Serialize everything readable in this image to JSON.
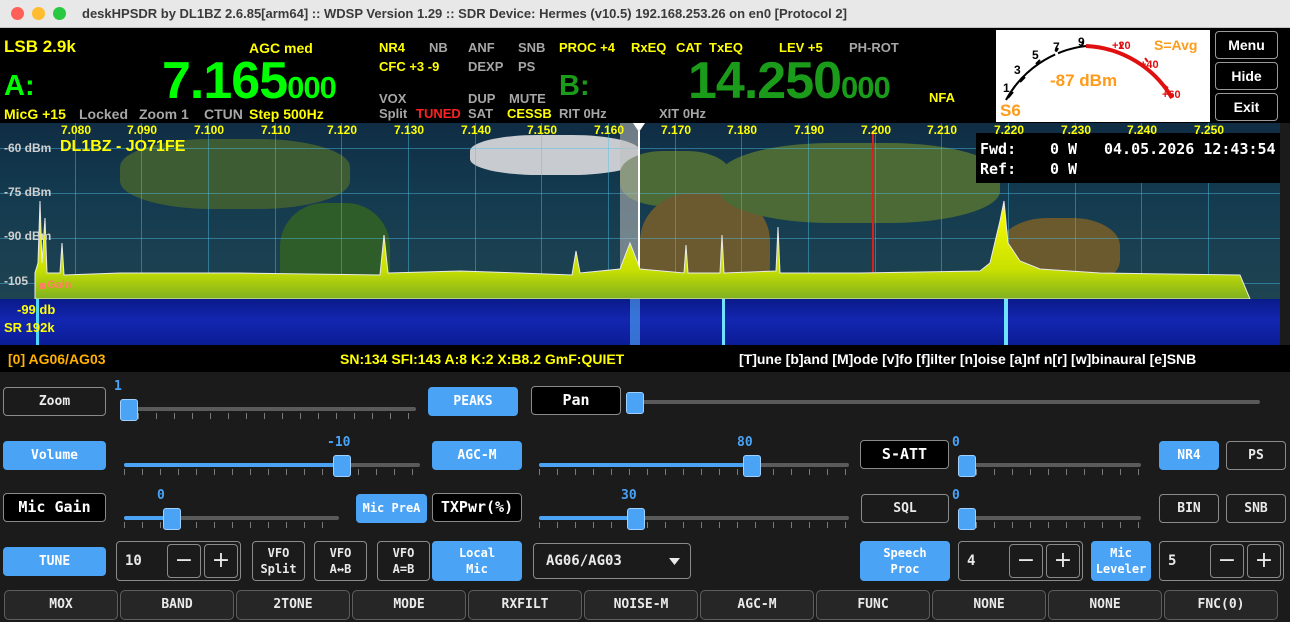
{
  "window": {
    "title": "deskHPSDR by DL1BZ 2.6.85[arm64] :: WDSP Version 1.29 :: SDR Device: Hermes (v10.5) 192.168.253.26 on en0 [Protocol 2]"
  },
  "vfo_a": {
    "mode_filter": "LSB 2.9k",
    "agc": "AGC med",
    "label": "A:",
    "freq_main": "7.165",
    "freq_small": "000",
    "mic_gain": "MicG +15",
    "locked": "Locked",
    "zoom": "Zoom 1",
    "ctun": "CTUN",
    "step": "Step 500Hz"
  },
  "status": {
    "nr": "NR4",
    "nb": "NB",
    "anf": "ANF",
    "snb": "SNB",
    "cfc": "CFC +3 -9",
    "dexp": "DEXP",
    "ps": "PS",
    "vox": "VOX",
    "dup": "DUP",
    "mute": "MUTE",
    "split": "Split",
    "tuned": "TUNED",
    "sat": "SAT",
    "cessb": "CESSB",
    "rit": "RIT 0Hz",
    "xit": "XIT 0Hz",
    "proc": "PROC +4",
    "rxeq": "RxEQ",
    "cat": "CAT",
    "txeq": "TxEQ",
    "lev": "LEV +5",
    "phrot": "PH-ROT"
  },
  "vfo_b": {
    "label": "B:",
    "freq_main": "14.250",
    "freq_small": "000",
    "nfa": "NFA"
  },
  "meter": {
    "reading": "-87 dBm",
    "s_unit": "S6",
    "mode": "S=Avg",
    "scale": [
      "1",
      "3",
      "5",
      "7",
      "9",
      "+20",
      "+40",
      "+60"
    ],
    "needle_value": "7"
  },
  "side_menu": {
    "menu": "Menu",
    "hide": "Hide",
    "exit": "Exit"
  },
  "panadapter": {
    "freq_ticks": [
      "7.080",
      "7.090",
      "7.100",
      "7.110",
      "7.120",
      "7.130",
      "7.140",
      "7.150",
      "7.160",
      "7.170",
      "7.180",
      "7.190",
      "7.200",
      "7.210",
      "7.220",
      "7.230",
      "7.240",
      "7.250"
    ],
    "db_labels": [
      "-60 dBm",
      "-75 dBm",
      "-90 dBm",
      "-105"
    ],
    "callsign": "DL1BZ - JO71FE",
    "fwd_label": "Fwd:",
    "fwd_value": "0 W",
    "datetime": "04.05.2026 12:43:54",
    "ref_label": "Ref:",
    "ref_value": "0 W",
    "gain_label": "Gain",
    "wf_level": "-99 db",
    "sample_rate": "SR 192k"
  },
  "info_bar": {
    "antenna": "[0] AG06/AG03",
    "propagation": "SN:134 SFI:143 A:8 K:2 X:B8.2 GmF:QUIET",
    "hotkeys": "[T]une [b]and [M]ode [v]fo [f]ilter [n]oise [a]nf n[r] [w]binaural [e]SNB"
  },
  "controls": {
    "zoom": {
      "label": "Zoom",
      "value": "1",
      "level": 0.0
    },
    "peaks": "PEAKS",
    "pan": {
      "label": "Pan",
      "level": 0.0
    },
    "volume": {
      "label": "Volume",
      "value": "-10",
      "level": 0.75
    },
    "agc": {
      "label": "AGC-M",
      "value": "80",
      "level": 0.7
    },
    "satt": {
      "label": "S-ATT",
      "value": "0",
      "level": 0.0
    },
    "nr4": "NR4",
    "ps": "PS",
    "mic_gain": {
      "label": "Mic Gain",
      "value": "0",
      "level": 0.2
    },
    "mic_prea": "Mic PreA",
    "txpwr": {
      "label": "TXPwr(%)",
      "value": "30",
      "level": 0.3
    },
    "sql": {
      "label": "SQL",
      "value": "0",
      "level": 0.0
    },
    "bin": "BIN",
    "snb": "SNB",
    "tune": "TUNE",
    "tune_spin": {
      "value": "10",
      "minus": "−",
      "plus": "+"
    },
    "vfo_split": [
      "VFO",
      "Split"
    ],
    "vfo_ab_swap": [
      "VFO",
      "A↔B"
    ],
    "vfo_ab_eq": [
      "VFO",
      "A=B"
    ],
    "local_mic": [
      "Local",
      "Mic"
    ],
    "antenna_select": "AG06/AG03",
    "speech_proc": [
      "Speech",
      "Proc"
    ],
    "proc_spin": {
      "value": "4",
      "minus": "−",
      "plus": "+"
    },
    "mic_leveler": [
      "Mic",
      "Leveler"
    ],
    "lev_spin": {
      "value": "5",
      "minus": "−",
      "plus": "+"
    }
  },
  "function_keys": [
    "MOX",
    "BAND",
    "2TONE",
    "MODE",
    "RXFILT",
    "NOISE-M",
    "AGC-M",
    "FUNC",
    "NONE",
    "NONE",
    "FNC(0)"
  ],
  "colors": {
    "accent": "#4aa3f5",
    "vfo_a": "#00ff00",
    "vfo_b": "#1a9c1a",
    "status_yellow": "#ffff00",
    "alert_red": "#ff2020",
    "meter_orange": "#ff9b1a"
  }
}
